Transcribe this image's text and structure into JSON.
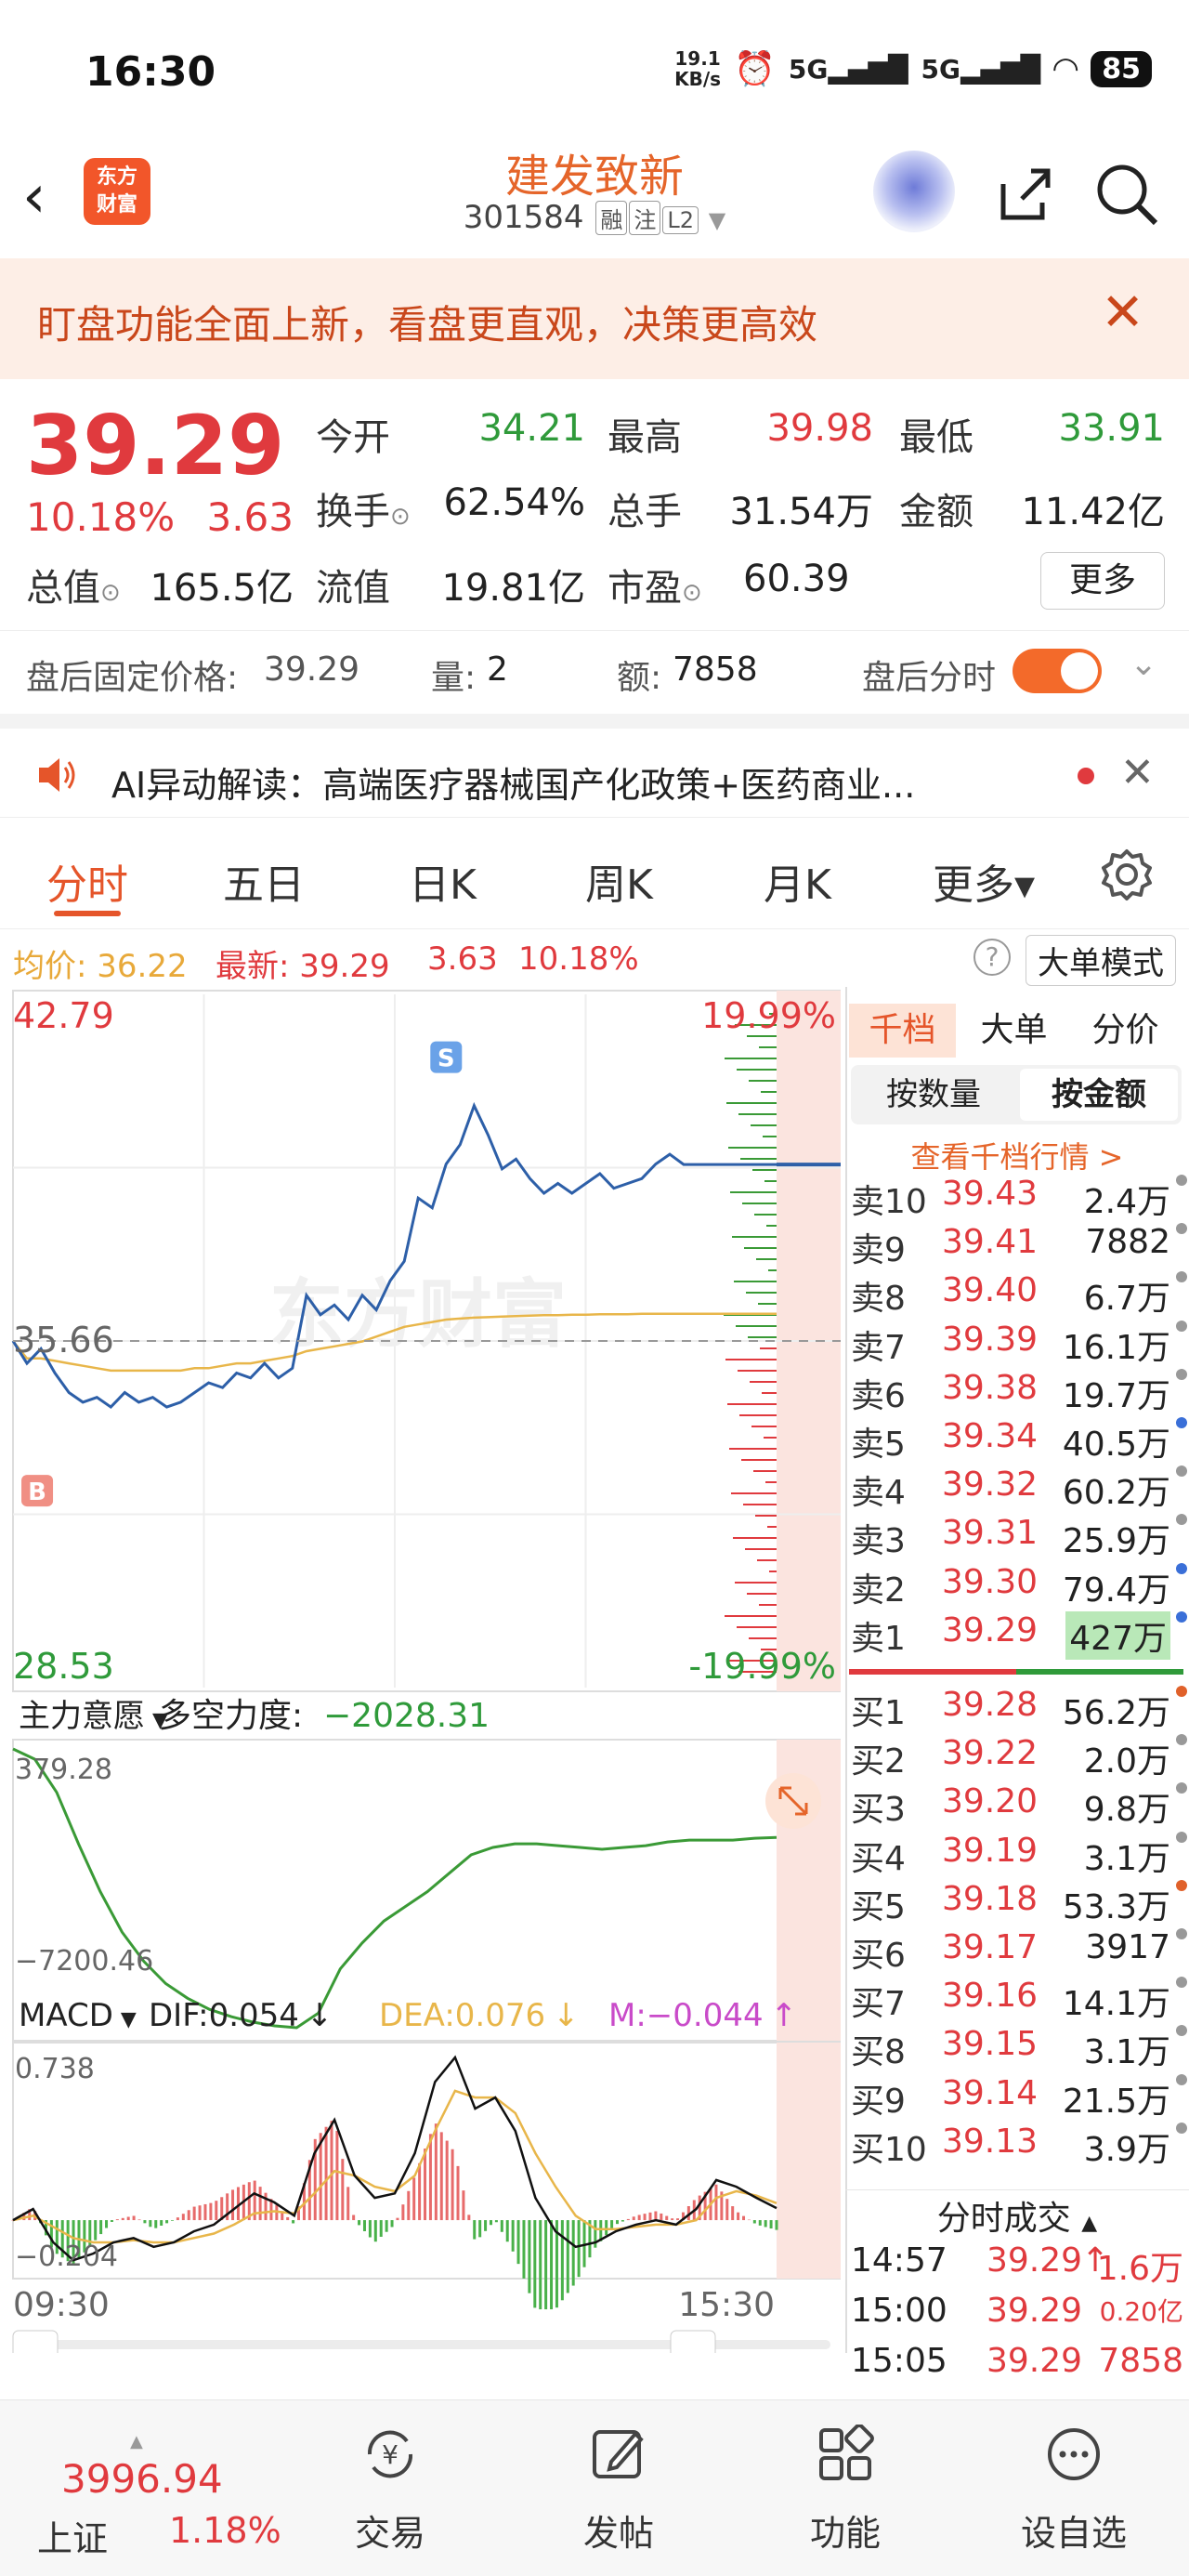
{
  "status_bar": {
    "time": "16:30",
    "net_speed_top": "19.1",
    "net_speed_unit": "KB/s",
    "sig1": "5G",
    "sig2": "5G",
    "battery": "85"
  },
  "nav": {
    "logo_line1": "东方",
    "logo_line2": "财富",
    "name": "建发致新",
    "code": "301584",
    "tag1": "融",
    "tag2": "注",
    "tag3": "L2"
  },
  "banner": {
    "text": "盯盘功能全面上新，看盘更直观，决策更高效"
  },
  "quote": {
    "price": "39.29",
    "change_pct": "10.18%",
    "change_abs": "3.63",
    "open_label": "今开",
    "open": "34.21",
    "high_label": "最高",
    "high": "39.98",
    "low_label": "最低",
    "low": "33.91",
    "turnover_label": "换手",
    "turnover": "62.54%",
    "volume_label": "总手",
    "volume": "31.54万",
    "amount_label": "金额",
    "amount": "11.42亿",
    "mktcap_label": "总值",
    "mktcap": "165.5亿",
    "float_label": "流值",
    "float": "19.81亿",
    "pe_label": "市盈",
    "pe": "60.39",
    "more": "更多",
    "after_price_label": "盘后固定价格:",
    "after_price": "39.29",
    "after_vol_label": "量:",
    "after_vol": "2",
    "after_amt_label": "额:",
    "after_amt": "7858",
    "after_toggle_label": "盘后分时"
  },
  "ai_bar": {
    "text": "AI异动解读：高端医疗器械国产化政策+医药商业..."
  },
  "tabs": [
    "分时",
    "五日",
    "日K",
    "周K",
    "月K",
    "更多▾"
  ],
  "legend": {
    "avg_label": "均价:",
    "avg": "36.22",
    "last_label": "最新:",
    "last": "39.29",
    "chg": "3.63",
    "pct": "10.18%",
    "big_mode": "大单模式"
  },
  "main_chart": {
    "y_max": "42.79",
    "y_min": "28.53",
    "pct_max": "19.99%",
    "pct_min": "-19.99%",
    "ref_price": "35.66",
    "start_time": "09:30",
    "end_time": "15:30",
    "watermark": "东方财富",
    "marker_s": "S",
    "marker_b": "B"
  },
  "chart_data": [
    {
      "type": "line",
      "title": "",
      "x_label": "",
      "series": [
        {
          "name": "",
          "values": [
            35.66,
            35.2,
            35.5,
            35.0,
            34.6,
            34.4,
            34.5,
            34.3,
            34.6,
            34.4,
            34.5,
            34.3,
            34.4,
            34.6,
            34.8,
            34.7,
            35.0,
            34.9,
            35.2,
            34.9,
            35.1,
            36.6,
            36.2,
            36.4,
            36.1,
            36.6,
            36.3,
            36.9,
            37.3,
            38.6,
            38.4,
            39.3,
            39.7,
            40.5,
            39.9,
            39.2,
            39.4,
            39.0,
            38.7,
            38.9,
            38.7,
            38.9,
            39.1,
            38.8,
            38.9,
            39.0,
            39.3,
            39.5,
            39.29
          ]
        },
        {
          "name": "均价",
          "values": [
            35.66,
            35.3,
            35.3,
            35.25,
            35.2,
            35.15,
            35.1,
            35.05,
            35.05,
            35.05,
            35.05,
            35.05,
            35.05,
            35.1,
            35.1,
            35.15,
            35.2,
            35.2,
            35.25,
            35.3,
            35.35,
            35.45,
            35.5,
            35.55,
            35.6,
            35.65,
            35.75,
            35.85,
            35.95,
            36.0,
            36.05,
            36.1,
            36.12,
            36.14,
            36.15,
            36.16,
            36.17,
            36.18,
            36.19,
            36.19,
            36.2,
            36.2,
            36.21,
            36.21,
            36.21,
            36.22,
            36.22,
            36.22,
            36.22
          ]
        }
      ],
      "ylim": [
        28.53,
        42.79
      ]
    },
    {
      "type": "line",
      "title": "",
      "series": [
        {
          "name": "主力意愿",
          "values": [
            379.28,
            100,
            -800,
            -2200,
            -3500,
            -4600,
            -5400,
            -6000,
            -6400,
            -6700,
            -6900,
            -7050,
            -7150,
            -7200.46,
            -6800,
            -5600,
            -4900,
            -4300,
            -3900,
            -3500,
            -3000,
            -2500,
            -2300,
            -2200,
            -2200,
            -2250,
            -2300,
            -2350,
            -2300,
            -2250,
            -2150,
            -2100,
            -2100,
            -2100,
            -2050,
            -2028.31
          ]
        }
      ],
      "ylim": [
        -7200.46,
        379.28
      ]
    },
    {
      "type": "line",
      "title": "",
      "series": [
        {
          "name": "DIF",
          "values": [
            0.0,
            0.05,
            -0.1,
            -0.18,
            -0.15,
            -0.1,
            -0.08,
            -0.12,
            -0.1,
            -0.05,
            -0.02,
            0.05,
            0.12,
            0.08,
            0.02,
            0.3,
            0.45,
            0.2,
            0.1,
            0.12,
            0.3,
            0.62,
            0.73,
            0.5,
            0.55,
            0.4,
            0.1,
            -0.05,
            -0.12,
            -0.1,
            -0.05,
            -0.02,
            0.0,
            -0.02,
            0.05,
            0.18,
            0.15,
            0.1,
            0.054
          ]
        },
        {
          "name": "DEA",
          "values": [
            0.0,
            0.02,
            -0.03,
            -0.08,
            -0.1,
            -0.1,
            -0.09,
            -0.1,
            -0.1,
            -0.08,
            -0.06,
            -0.02,
            0.03,
            0.04,
            0.03,
            0.12,
            0.22,
            0.2,
            0.15,
            0.13,
            0.2,
            0.4,
            0.58,
            0.55,
            0.55,
            0.48,
            0.3,
            0.15,
            0.02,
            -0.04,
            -0.04,
            -0.03,
            -0.02,
            -0.02,
            0.0,
            0.1,
            0.13,
            0.11,
            0.076
          ]
        }
      ],
      "ylim": [
        -0.204,
        0.738
      ]
    }
  ],
  "force_panel": {
    "label": "主力意愿",
    "force_label": "多空力度:",
    "force_value": "−2028.31",
    "y_max": "379.28",
    "y_min": "−7200.46"
  },
  "macd_panel": {
    "label": "MACD",
    "dif": "DIF:0.054",
    "dif_arrow": "↓",
    "dea": "DEA:0.076",
    "dea_arrow": "↓",
    "m": "M:−0.044",
    "m_arrow": "↑",
    "y_max": "0.738",
    "y_min": "−0.204"
  },
  "order_book": {
    "tabs": [
      "千档",
      "大单",
      "分价"
    ],
    "seg": [
      "按数量",
      "按金额"
    ],
    "link": "查看千档行情 >",
    "asks": [
      {
        "label": "卖10",
        "price": "39.43",
        "vol": "2.4万",
        "dot": "#999999"
      },
      {
        "label": "卖9",
        "price": "39.41",
        "vol": "7882",
        "dot": "#999999"
      },
      {
        "label": "卖8",
        "price": "39.40",
        "vol": "6.7万",
        "dot": "#999999"
      },
      {
        "label": "卖7",
        "price": "39.39",
        "vol": "16.1万",
        "dot": "#999999"
      },
      {
        "label": "卖6",
        "price": "39.38",
        "vol": "19.7万",
        "dot": "#999999"
      },
      {
        "label": "卖5",
        "price": "39.34",
        "vol": "40.5万",
        "dot": "#3a6fd8"
      },
      {
        "label": "卖4",
        "price": "39.32",
        "vol": "60.2万",
        "dot": "#999999"
      },
      {
        "label": "卖3",
        "price": "39.31",
        "vol": "25.9万",
        "dot": "#999999"
      },
      {
        "label": "卖2",
        "price": "39.30",
        "vol": "79.4万",
        "dot": "#3a6fd8"
      },
      {
        "label": "卖1",
        "price": "39.29",
        "vol": "427万",
        "dot": "#3a6fd8"
      }
    ],
    "bids": [
      {
        "label": "买1",
        "price": "39.28",
        "vol": "56.2万",
        "dot": "#e0612a"
      },
      {
        "label": "买2",
        "price": "39.22",
        "vol": "2.0万",
        "dot": "#999999"
      },
      {
        "label": "买3",
        "price": "39.20",
        "vol": "9.8万",
        "dot": "#999999"
      },
      {
        "label": "买4",
        "price": "39.19",
        "vol": "3.1万",
        "dot": "#999999"
      },
      {
        "label": "买5",
        "price": "39.18",
        "vol": "53.3万",
        "dot": "#e0612a"
      },
      {
        "label": "买6",
        "price": "39.17",
        "vol": "3917",
        "dot": "#999999"
      },
      {
        "label": "买7",
        "price": "39.16",
        "vol": "14.1万",
        "dot": "#999999"
      },
      {
        "label": "买8",
        "price": "39.15",
        "vol": "3.1万",
        "dot": "#999999"
      },
      {
        "label": "买9",
        "price": "39.14",
        "vol": "21.5万",
        "dot": "#999999"
      },
      {
        "label": "买10",
        "price": "39.13",
        "vol": "3.9万",
        "dot": "#999999"
      }
    ],
    "trades_title": "分时成交",
    "trades": [
      {
        "time": "14:57",
        "price": "39.29",
        "arrow": "↑",
        "vol": "1.6万"
      },
      {
        "time": "15:00",
        "price": "39.29",
        "arrow": "",
        "vol": "0.20亿"
      },
      {
        "time": "15:05",
        "price": "39.29",
        "arrow": "",
        "vol": "7858"
      }
    ]
  },
  "bottom_nav": {
    "index_value": "3996.94",
    "index_name": "上证",
    "index_pct": "1.18%",
    "items": [
      "交易",
      "发帖",
      "功能",
      "设自选"
    ]
  },
  "colors": {
    "accent": "#e5552a",
    "up": "#e03a3e",
    "down": "#2f9a3a",
    "price_line": "#2d5fa8",
    "avg_line": "#e8b64a"
  }
}
